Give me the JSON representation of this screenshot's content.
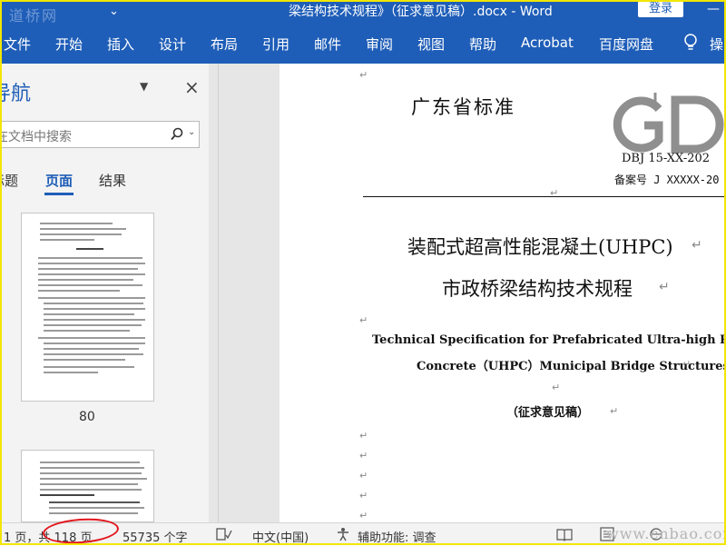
{
  "titlebar": {
    "watermark_logo": "道桥网",
    "quick_access_caret": "⌄",
    "title": "梁结构技术规程》（征求意见稿）.docx  -  Word",
    "login_label": "登录",
    "minimize_label": "—"
  },
  "ribbon": {
    "tabs": [
      "文件",
      "开始",
      "插入",
      "设计",
      "布局",
      "引用",
      "邮件",
      "审阅",
      "视图",
      "帮助",
      "Acrobat",
      "百度网盘",
      "操"
    ]
  },
  "nav": {
    "title": "导航",
    "search_placeholder": "在文档中搜索",
    "tabs": [
      "标题",
      "页面",
      "结果"
    ],
    "active_tab": "页面",
    "thumbnail_label": "80"
  },
  "document": {
    "province_standard": "广东省标准",
    "logo_text": "GD",
    "standard_number": "DBJ 15-XX-202",
    "record_number": "备案号 J XXXXX-20",
    "title_cn_line1": "装配式超高性能混凝土(UHPC)",
    "title_cn_line2": "市政桥梁结构技术规程",
    "title_en_line1": "Technical Specification for Prefabricated Ultra-high Performanc",
    "title_en_line2": "Concrete（UHPC）Municipal Bridge Structures",
    "draft_label": "（征求意见稿）",
    "paragraph_mark": "↵"
  },
  "status": {
    "page_info": "1 页，共 118 页",
    "word_count": "55735 个字",
    "language": "中文(中国)",
    "accessibility": "辅助功能: 调查",
    "watermark": "www.cnbao.com"
  },
  "colors": {
    "accent": "#1f5eb8",
    "highlight_oval": "#e3151c",
    "frame": "#f2e600"
  }
}
